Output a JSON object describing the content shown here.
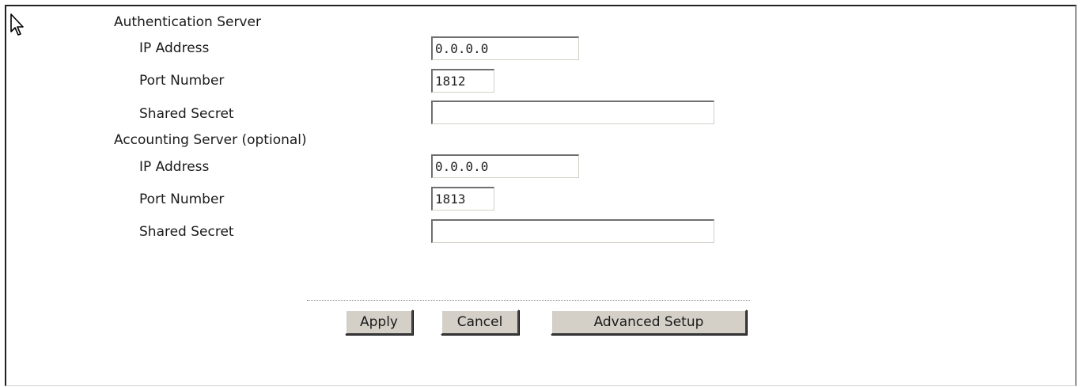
{
  "authentication": {
    "heading": "Authentication Server",
    "ip_label": "IP Address",
    "ip_value": "0.0.0.0",
    "port_label": "Port Number",
    "port_value": "1812",
    "secret_label": "Shared Secret",
    "secret_value": ""
  },
  "accounting": {
    "heading": "Accounting Server (optional)",
    "ip_label": "IP Address",
    "ip_value": "0.0.0.0",
    "port_label": "Port Number",
    "port_value": "1813",
    "secret_label": "Shared Secret",
    "secret_value": ""
  },
  "buttons": {
    "apply": "Apply",
    "cancel": "Cancel",
    "advanced": "Advanced Setup"
  },
  "icons": {
    "cursor": "mouse-pointer-icon"
  },
  "colors": {
    "button_face": "#d4d0c8",
    "text": "#1a1a1a",
    "background": "#ffffff"
  }
}
